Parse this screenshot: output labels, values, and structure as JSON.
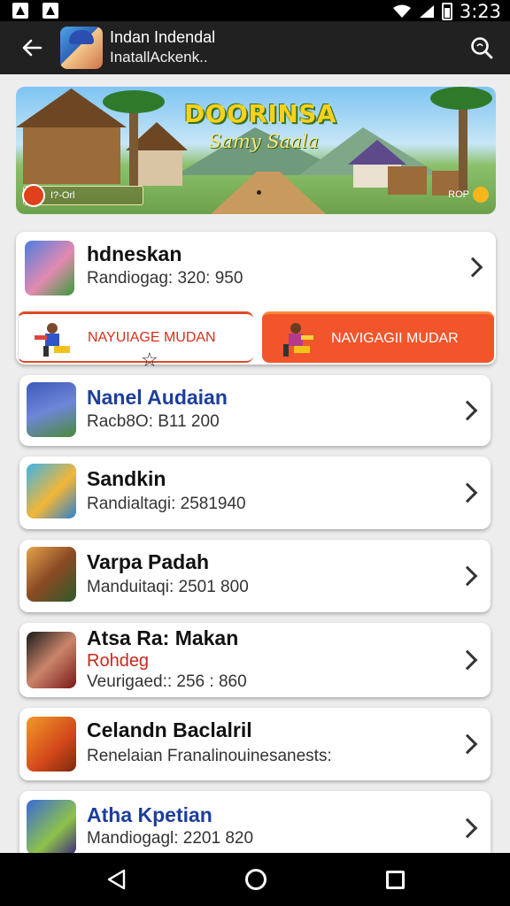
{
  "status_bar": {
    "time": "3:23"
  },
  "app_bar": {
    "title": "Indan Indendal",
    "subtitle": "InatallAckenk.."
  },
  "banner": {
    "title": "DOORINSA",
    "subtitle": "Samy Saala",
    "chip_text": "I?-Orl",
    "right_text": "ROP"
  },
  "items": [
    {
      "name": "hdneskan",
      "meta": "Randiogag: 320: 950",
      "title_color": "#1d3e9c"
    },
    {
      "name": "Nanel Audaian",
      "meta": "Racb8O: B11 200",
      "title_color": "#1d3e9c"
    },
    {
      "name": "Sandkin",
      "meta": "Randialtagi: 2581940",
      "title_color": "#111111"
    },
    {
      "name": "Varpa Padah",
      "meta": "Manduitaqi: 2501 800",
      "title_color": "#111111"
    },
    {
      "name": "Atsa Ra: Makan",
      "extra": "Rohdeg",
      "meta": "Veurigaed:: 256 : 860",
      "title_color": "#111111"
    },
    {
      "name": "Celandn Baclalril",
      "meta": "Renelaian Franalinouinesanests:",
      "title_color": "#111111"
    },
    {
      "name": "Atha Kpetian",
      "meta": "Mandiogagl: 2201 820",
      "title_color": "#1d3e9c"
    }
  ],
  "buttons": {
    "nav_left": "NAYUIAGE MUDAN",
    "nav_right": "NAVIGAGII MUDAR",
    "star": "☆"
  },
  "colors": {
    "accent_orange": "#f2552b",
    "appbar": "#212121",
    "link_blue": "#1d3e9c"
  },
  "icons": [
    "back-arrow-icon",
    "search-icon",
    "chevron-right-icon",
    "star-icon",
    "nav-back-icon",
    "nav-home-icon",
    "nav-recent-icon"
  ]
}
